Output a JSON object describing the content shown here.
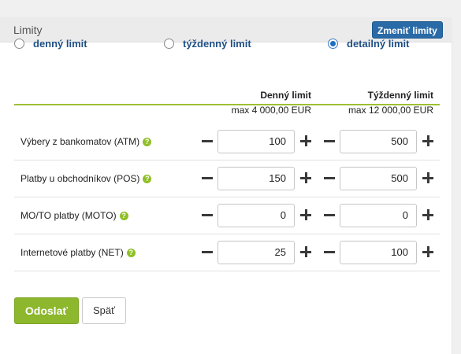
{
  "panel": {
    "title": "Limity",
    "change_button": "Zmeniť limity"
  },
  "radios": [
    {
      "label": "denný limit",
      "checked": false
    },
    {
      "label": "týždenný limit",
      "checked": false
    },
    {
      "label": "detailný limit",
      "checked": true
    }
  ],
  "columns": {
    "daily": {
      "title": "Denný limit",
      "max": "max 4 000,00 EUR"
    },
    "weekly": {
      "title": "Týždenný limit",
      "max": "max 12 000,00 EUR"
    }
  },
  "rows": [
    {
      "label": "Výbery z bankomatov (ATM)",
      "daily": "100",
      "weekly": "500"
    },
    {
      "label": "Platby u obchodníkov (POS)",
      "daily": "150",
      "weekly": "500"
    },
    {
      "label": "MO/TO platby (MOTO)",
      "daily": "0",
      "weekly": "0"
    },
    {
      "label": "Internetové platby (NET)",
      "daily": "25",
      "weekly": "100"
    }
  ],
  "help_glyph": "?",
  "buttons": {
    "send": "Odoslať",
    "back": "Späť"
  },
  "colors": {
    "accent_green": "#8db72d",
    "accent_blue": "#2a6aa6",
    "radio_label": "#1f4f86"
  }
}
